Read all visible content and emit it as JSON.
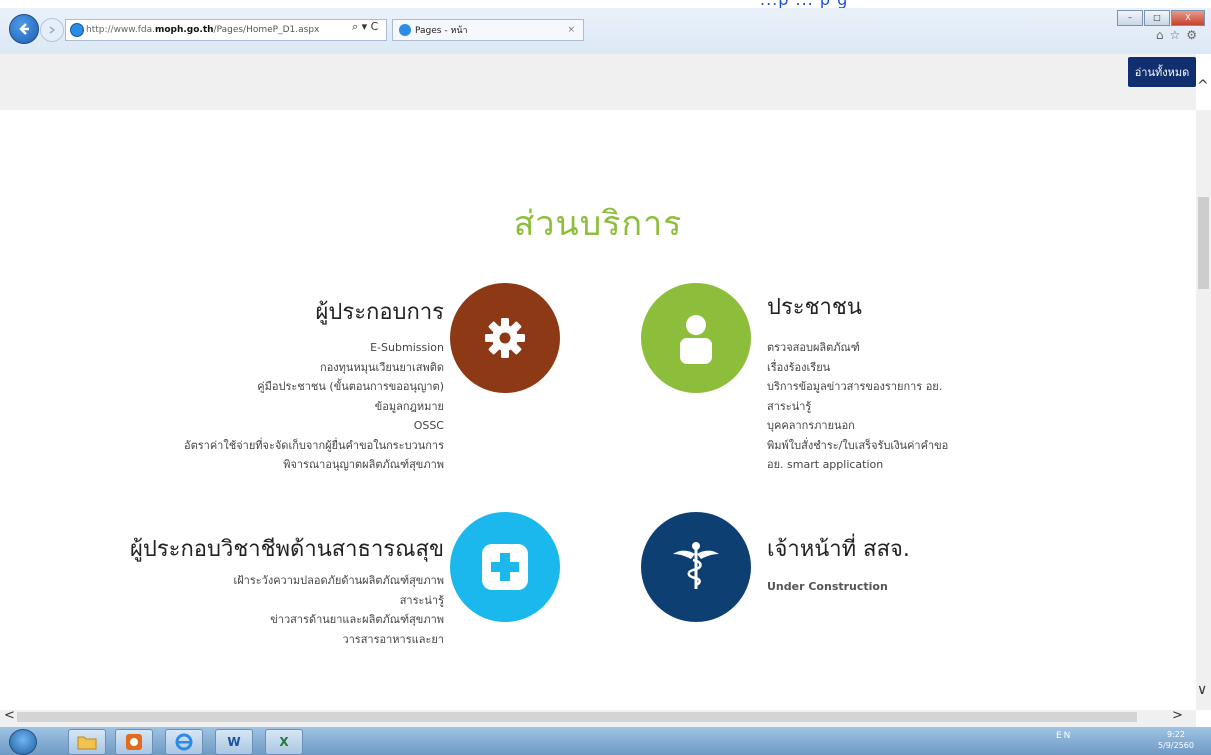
{
  "top_link": "...p ... p g",
  "browser": {
    "url_prefix": "http://www.fda.",
    "url_domain": "moph.go.th",
    "url_suffix": "/Pages/HomeP_D1.aspx",
    "search_glyph": "⌕ ▾ C",
    "tab_title": "Pages - หน้า",
    "tab_close": "×",
    "win_min": "–",
    "win_max": "□",
    "win_close": "X",
    "tools": "⌂☆⚙"
  },
  "header": {
    "read_all_label": "อ่านทั้งหมด",
    "caret_up": "^"
  },
  "main": {
    "title": "ส่วนบริการ",
    "operators": {
      "heading": "ผู้ประกอบการ",
      "items": [
        "E-Submission",
        "กองทุนหมุนเวียนยาเสพติด",
        "คู่มือประชาชน (ขั้นตอนการขออนุญาต)",
        "ข้อมูลกฎหมาย",
        "OSSC",
        "อัตราค่าใช้จ่ายที่จะจัดเก็บจากผู้ยื่นคำขอในกระบวนการ",
        "พิจารณาอนุญาตผลิตภัณฑ์สุขภาพ"
      ]
    },
    "public": {
      "heading": "ประชาชน",
      "items": [
        "ตรวจสอบผลิตภัณฑ์",
        "เรื่องร้องเรียน",
        "บริการข้อมูลข่าวสารของรายการ อย.",
        "สาระน่ารู้",
        "บุคคลากรภายนอก",
        "พิมพ์ใบสั่งชำระ/ใบเสร็จรับเงินค่าคำขอ",
        "อย. smart application"
      ]
    },
    "professionals": {
      "heading": "ผู้ประกอบวิชาชีพด้านสาธารณสุข",
      "items": [
        "เฝ้าระวังความปลอดภัยด้านผลิตภัณฑ์สุขภาพ",
        "สาระน่ารู้",
        "ข่าวสารด้านยาและผลิตภัณฑ์สุขภาพ",
        "วารสารอาหารและยา"
      ]
    },
    "staff": {
      "heading": "เจ้าหน้าที่ สสจ.",
      "items": [
        "Under Construction"
      ]
    }
  },
  "colors": {
    "title_green": "#8dbe3b",
    "operators_brown": "#8e3916",
    "public_green": "#8dbe3b",
    "pro_cyan": "#1ab8ec",
    "staff_navy": "#0d3f72",
    "button_navy": "#0f2f6e"
  },
  "icons": {
    "operators": "gear-icon",
    "public": "person-icon",
    "professionals": "medical-cross-icon",
    "staff": "caduceus-icon"
  },
  "scroll": {
    "left": "<",
    "right": ">",
    "down": "∨"
  },
  "taskbar": {
    "word_label": "W",
    "excel_label": "X",
    "tray_text": "EN",
    "time": "9:22",
    "date": "5/9/2560"
  }
}
